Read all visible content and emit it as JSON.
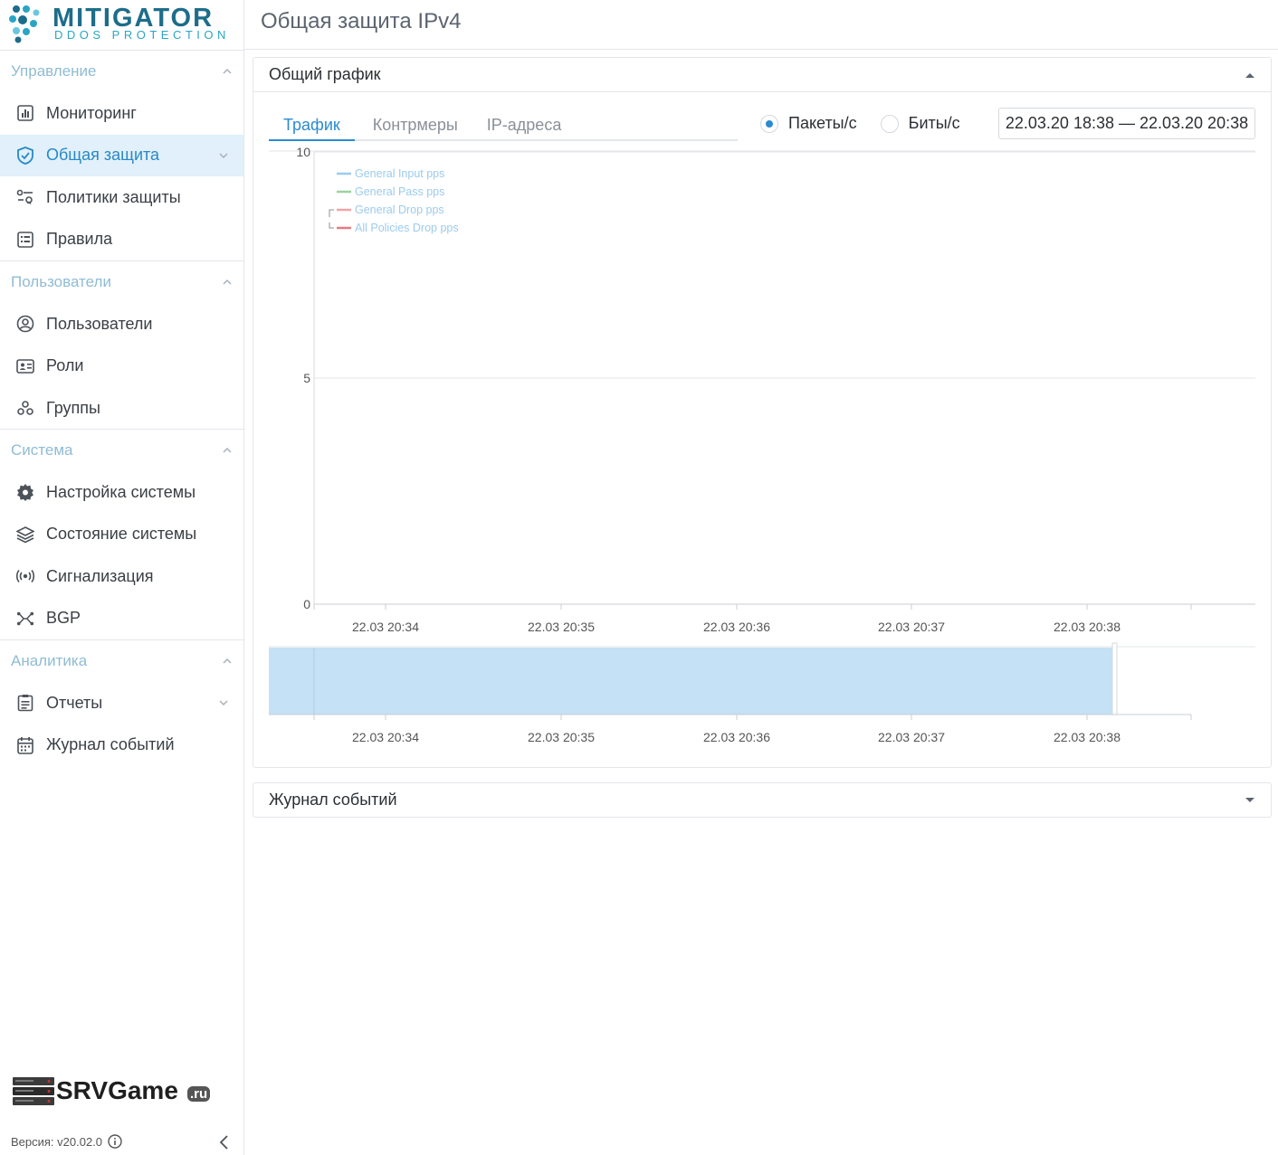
{
  "brand": {
    "title": "MITIGATOR",
    "subtitle": "DDOS PROTECTION",
    "partner": "SRVGame",
    "partner_suffix": ".ru"
  },
  "sidebar": {
    "sections": [
      {
        "title": "Управление",
        "items": [
          {
            "label": "Мониторинг",
            "icon": "chart-box-icon"
          },
          {
            "label": "Общая защита",
            "icon": "shield-check-icon",
            "active": true,
            "expandable": true
          },
          {
            "label": "Политики защиты",
            "icon": "policy-icon"
          },
          {
            "label": "Правила",
            "icon": "list-box-icon"
          }
        ]
      },
      {
        "title": "Пользователи",
        "items": [
          {
            "label": "Пользователи",
            "icon": "user-circle-icon"
          },
          {
            "label": "Роли",
            "icon": "id-card-icon"
          },
          {
            "label": "Группы",
            "icon": "group-icon"
          }
        ]
      },
      {
        "title": "Система",
        "items": [
          {
            "label": "Настройка системы",
            "icon": "gear-icon"
          },
          {
            "label": "Состояние системы",
            "icon": "layers-icon"
          },
          {
            "label": "Сигнализация",
            "icon": "broadcast-icon"
          },
          {
            "label": "BGP",
            "icon": "bgp-icon"
          }
        ]
      },
      {
        "title": "Аналитика",
        "items": [
          {
            "label": "Отчеты",
            "icon": "clipboard-icon",
            "expandable": true
          },
          {
            "label": "Журнал событий",
            "icon": "calendar-icon"
          }
        ]
      }
    ],
    "version": "Версия: v20.02.0"
  },
  "page": {
    "title": "Общая защита IPv4"
  },
  "chart_card": {
    "title": "Общий график",
    "tabs": [
      "Трафик",
      "Контрмеры",
      "IP-адреса"
    ],
    "active_tab": "Трафик",
    "units": [
      "Пакеты/с",
      "Биты/с"
    ],
    "selected_unit": "Пакеты/с",
    "date_range": "22.03.20 18:38 — 22.03.20 20:38"
  },
  "events_card": {
    "title": "Журнал событий"
  },
  "chart_data": {
    "type": "line",
    "title": "",
    "xlabel": "",
    "ylabel": "",
    "ylim": [
      0,
      10
    ],
    "y_ticks": [
      "10",
      "5",
      "0"
    ],
    "x_ticks": [
      "22.03 20:34",
      "22.03 20:35",
      "22.03 20:36",
      "22.03 20:37",
      "22.03 20:38"
    ],
    "series": [
      {
        "name": "General Input pps",
        "color": "#9ccbec",
        "values": []
      },
      {
        "name": "General Pass pps",
        "color": "#9ad3a0",
        "values": []
      },
      {
        "name": "General Drop pps",
        "color": "#f1a3a8",
        "values": []
      },
      {
        "name": "All Policies Drop pps",
        "color": "#e57b82",
        "values": []
      }
    ],
    "legend_position": "top-left",
    "grid": true,
    "navigator": {
      "x_ticks": [
        "22.03 20:34",
        "22.03 20:35",
        "22.03 20:36",
        "22.03 20:37",
        "22.03 20:38"
      ],
      "selection_color": "#c4e1f5"
    }
  }
}
